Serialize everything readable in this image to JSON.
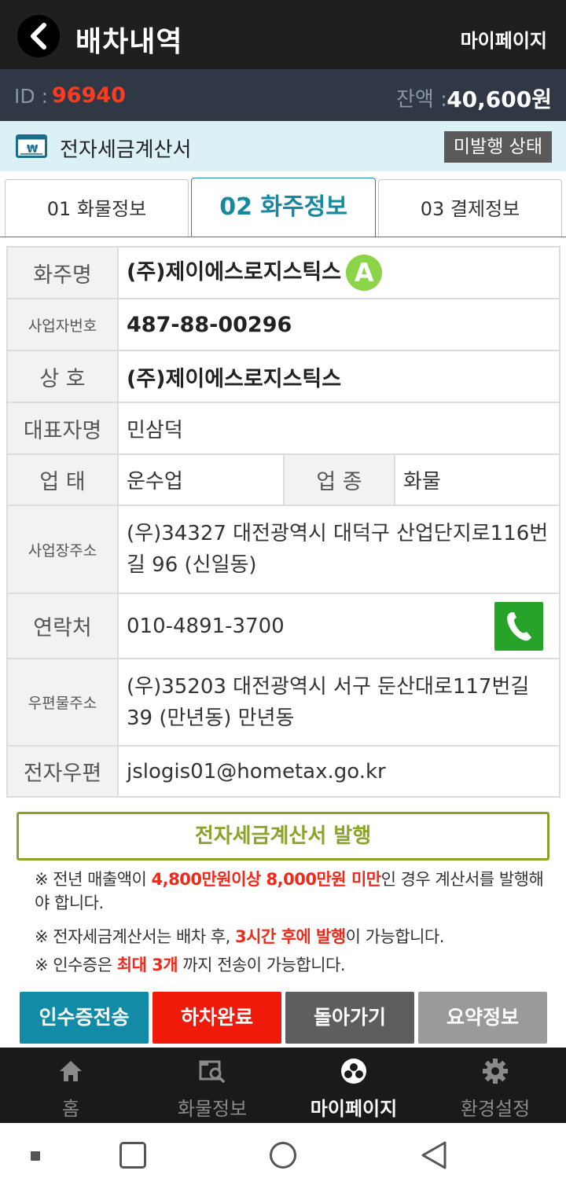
{
  "header": {
    "title": "배차내역",
    "mypage_link": "마이페이지"
  },
  "account": {
    "id_label": "ID :",
    "id_value": "96940",
    "balance_label": "잔액 :",
    "balance_value": "40,600원"
  },
  "tax_invoice": {
    "title": "전자세금계산서",
    "status": "미발행 상태"
  },
  "tabs": [
    {
      "label": "01 화물정보"
    },
    {
      "label": "02 화주정보"
    },
    {
      "label": "03 결제정보"
    }
  ],
  "shipper": {
    "name_label": "화주명",
    "name_value": "(주)제이에스로지스틱스",
    "grade": "A",
    "biz_no_label": "사업자번호",
    "biz_no_value": "487-88-00296",
    "trade_label": "상 호",
    "trade_value": "(주)제이에스로지스틱스",
    "ceo_label": "대표자명",
    "ceo_value": "민삼덕",
    "biz_type_label": "업 태",
    "biz_type_value": "운수업",
    "biz_item_label": "업 종",
    "biz_item_value": "화물",
    "address_label": "사업장주소",
    "address_value": "(우)34327 대전광역시 대덕구 산업단지로116번길 96 (신일동)",
    "contact_label": "연락처",
    "contact_value": "010-4891-3700",
    "mail_address_label": "우편물주소",
    "mail_address_value": "(우)35203 대전광역시 서구 둔산대로117번길 39 (만년동) 만년동",
    "email_label": "전자우편",
    "email_value": "jslogis01@hometax.go.kr"
  },
  "issue_button": "전자세금계산서 발행",
  "notes": {
    "n1_pre": "※ 전년 매출액이 ",
    "n1_red": "4,800만원이상 8,000만원 미만",
    "n1_post": "인 경우 계산서를 발행해야 합니다.",
    "n2_pre": "※ 전자세금계산서는 배차 후, ",
    "n2_red": "3시간 후에 발행",
    "n2_post": "이 가능합니다.",
    "n3_pre": "※ 인수증은 ",
    "n3_red": "최대 3개",
    "n3_post": " 까지 전송이 가능합니다."
  },
  "actions": {
    "receipt": "인수증전송",
    "unload": "하차완료",
    "back": "돌아가기",
    "summary": "요약정보"
  },
  "nav": [
    {
      "label": "홈",
      "icon": "home-icon"
    },
    {
      "label": "화물정보",
      "icon": "cargo-search-icon"
    },
    {
      "label": "마이페이지",
      "icon": "mypage-icon"
    },
    {
      "label": "환경설정",
      "icon": "gear-icon"
    }
  ],
  "colors": {
    "header_bg": "#1f1f1f",
    "id_value": "#ff3b1f",
    "tab_active": "#14899f",
    "grade_badge": "#8bd448",
    "phone_button": "#28a32a",
    "issue_button": "#8aa42a",
    "note_red": "#f02a1a",
    "receipt_button": "#128ca6",
    "unload_button": "#f01a0a",
    "back_button": "#5e5e5e",
    "summary_button": "#9a9a9a"
  }
}
